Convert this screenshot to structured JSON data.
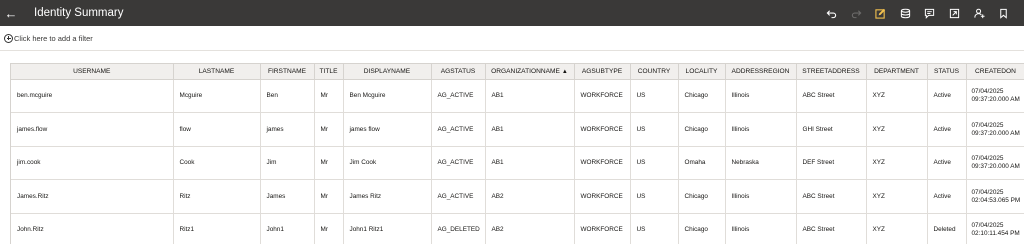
{
  "header": {
    "title": "Identity Summary"
  },
  "toolbar": {
    "icons": [
      "undo-icon",
      "redo-icon",
      "edit-icon",
      "database-icon",
      "comment-icon",
      "export-icon",
      "user-settings-icon",
      "bookmark-icon"
    ]
  },
  "filter": {
    "label": "Click here to add a filter"
  },
  "grid": {
    "columns": [
      "USERNAME",
      "LASTNAME",
      "FIRSTNAME",
      "TITLE",
      "DISPLAYNAME",
      "AGSTATUS",
      "ORGANIZATIONNAME",
      "AGSUBTYPE",
      "COUNTRY",
      "LOCALITY",
      "ADDRESSREGION",
      "STREETADDRESS",
      "DEPARTMENT",
      "STATUS",
      "CREATEDON"
    ],
    "sorted_column": "ORGANIZATIONNAME",
    "sort_arrow": "▲",
    "rows": [
      [
        "ben.mcguire",
        "Mcguire",
        "Ben",
        "Mr",
        "Ben Mcguire",
        "AG_ACTIVE",
        "AB1",
        "WORKFORCE",
        "US",
        "Chicago",
        "Illinois",
        "ABC Street",
        "XYZ",
        "Active",
        "07/04/2025 09:37:20.000 AM"
      ],
      [
        "james.flow",
        "flow",
        "james",
        "Mr",
        "james flow",
        "AG_ACTIVE",
        "AB1",
        "WORKFORCE",
        "US",
        "Chicago",
        "Illinois",
        "GHI Street",
        "XYZ",
        "Active",
        "07/04/2025 09:37:20.000 AM"
      ],
      [
        "jim.cook",
        "Cook",
        "Jim",
        "Mr",
        "Jim Cook",
        "AG_ACTIVE",
        "AB1",
        "WORKFORCE",
        "US",
        "Omaha",
        "Nebraska",
        "DEF Street",
        "XYZ",
        "Active",
        "07/04/2025 09:37:20.000 AM"
      ],
      [
        "James.Ritz",
        "Ritz",
        "James",
        "Mr",
        "James Ritz",
        "AG_ACTIVE",
        "AB2",
        "WORKFORCE",
        "US",
        "Chicago",
        "Illinois",
        "ABC Street",
        "XYZ",
        "Active",
        "07/04/2025 02:04:53.065 PM"
      ],
      [
        "John.Ritz",
        "Ritz1",
        "John1",
        "Mr",
        "John1 Ritz1",
        "AG_DELETED",
        "AB2",
        "WORKFORCE",
        "US",
        "Chicago",
        "Illinois",
        "ABC Street",
        "XYZ",
        "Deleted",
        "07/04/2025 02:10:11.454 PM"
      ]
    ]
  }
}
